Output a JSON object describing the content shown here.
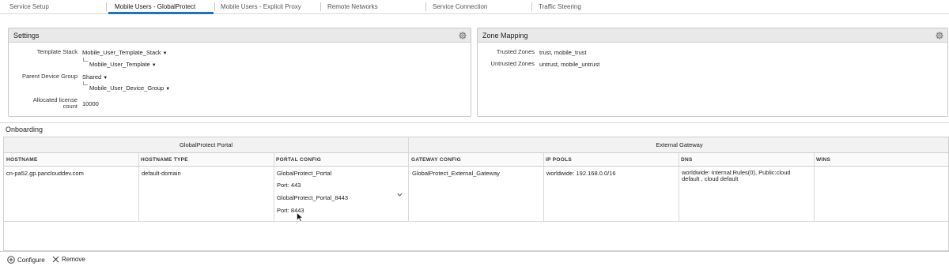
{
  "tabs": [
    {
      "label": "Service Setup",
      "active": false
    },
    {
      "label": "Mobile Users - GlobalProtect",
      "active": true
    },
    {
      "label": "Mobile Users - Explicit Proxy",
      "active": false
    },
    {
      "label": "Remote Networks",
      "active": false
    },
    {
      "label": "Service Connection",
      "active": false
    },
    {
      "label": "Traffic Steering",
      "active": false
    }
  ],
  "settings": {
    "title": "Settings",
    "template_stack_label": "Template Stack",
    "template_stack_value": "Mobile_User_Template_Stack",
    "template_value": "Mobile_User_Template",
    "parent_device_group_label": "Parent Device Group",
    "parent_device_group_value": "Shared",
    "device_group_value": "Mobile_User_Device_Group",
    "allocated_license_label_1": "Allocated license",
    "allocated_license_label_2": "count",
    "allocated_license_value": "10000"
  },
  "zone_mapping": {
    "title": "Zone Mapping",
    "trusted_label": "Trusted Zones",
    "trusted_value": "trust, mobile_trust",
    "untrusted_label": "Untrusted Zones",
    "untrusted_value": "untrust, mobile_untrust"
  },
  "onboarding": {
    "title": "Onboarding",
    "group_portal": "GlobalProtect Portal",
    "group_gateway": "External Gateway",
    "columns": {
      "hostname": "HOSTNAME",
      "hostname_type": "HOSTNAME TYPE",
      "portal_config": "PORTAL CONFIG",
      "gateway_config": "GATEWAY CONFIG",
      "ip_pools": "IP POOLS",
      "dns": "DNS",
      "wins": "WINS"
    },
    "row": {
      "hostname": "cn-pa52.gp.panclouddev.com",
      "hostname_type": "default-domain",
      "portal_1": "GlobalProtect_Portal",
      "port_1": "Port: 443",
      "portal_2": "GlobalProtect_Portal_8443",
      "port_2": "Port: 8443",
      "gateway_config": "GlobalProtect_External_Gateway",
      "ip_pools": "worldwide: 192.168.0.0/16",
      "dns_line1": "worldwide: Internal:Rules(0), Public:cloud",
      "dns_line2": "default , cloud default",
      "wins": ""
    }
  },
  "footer": {
    "configure_label": "Configure",
    "remove_label": "Remove"
  }
}
